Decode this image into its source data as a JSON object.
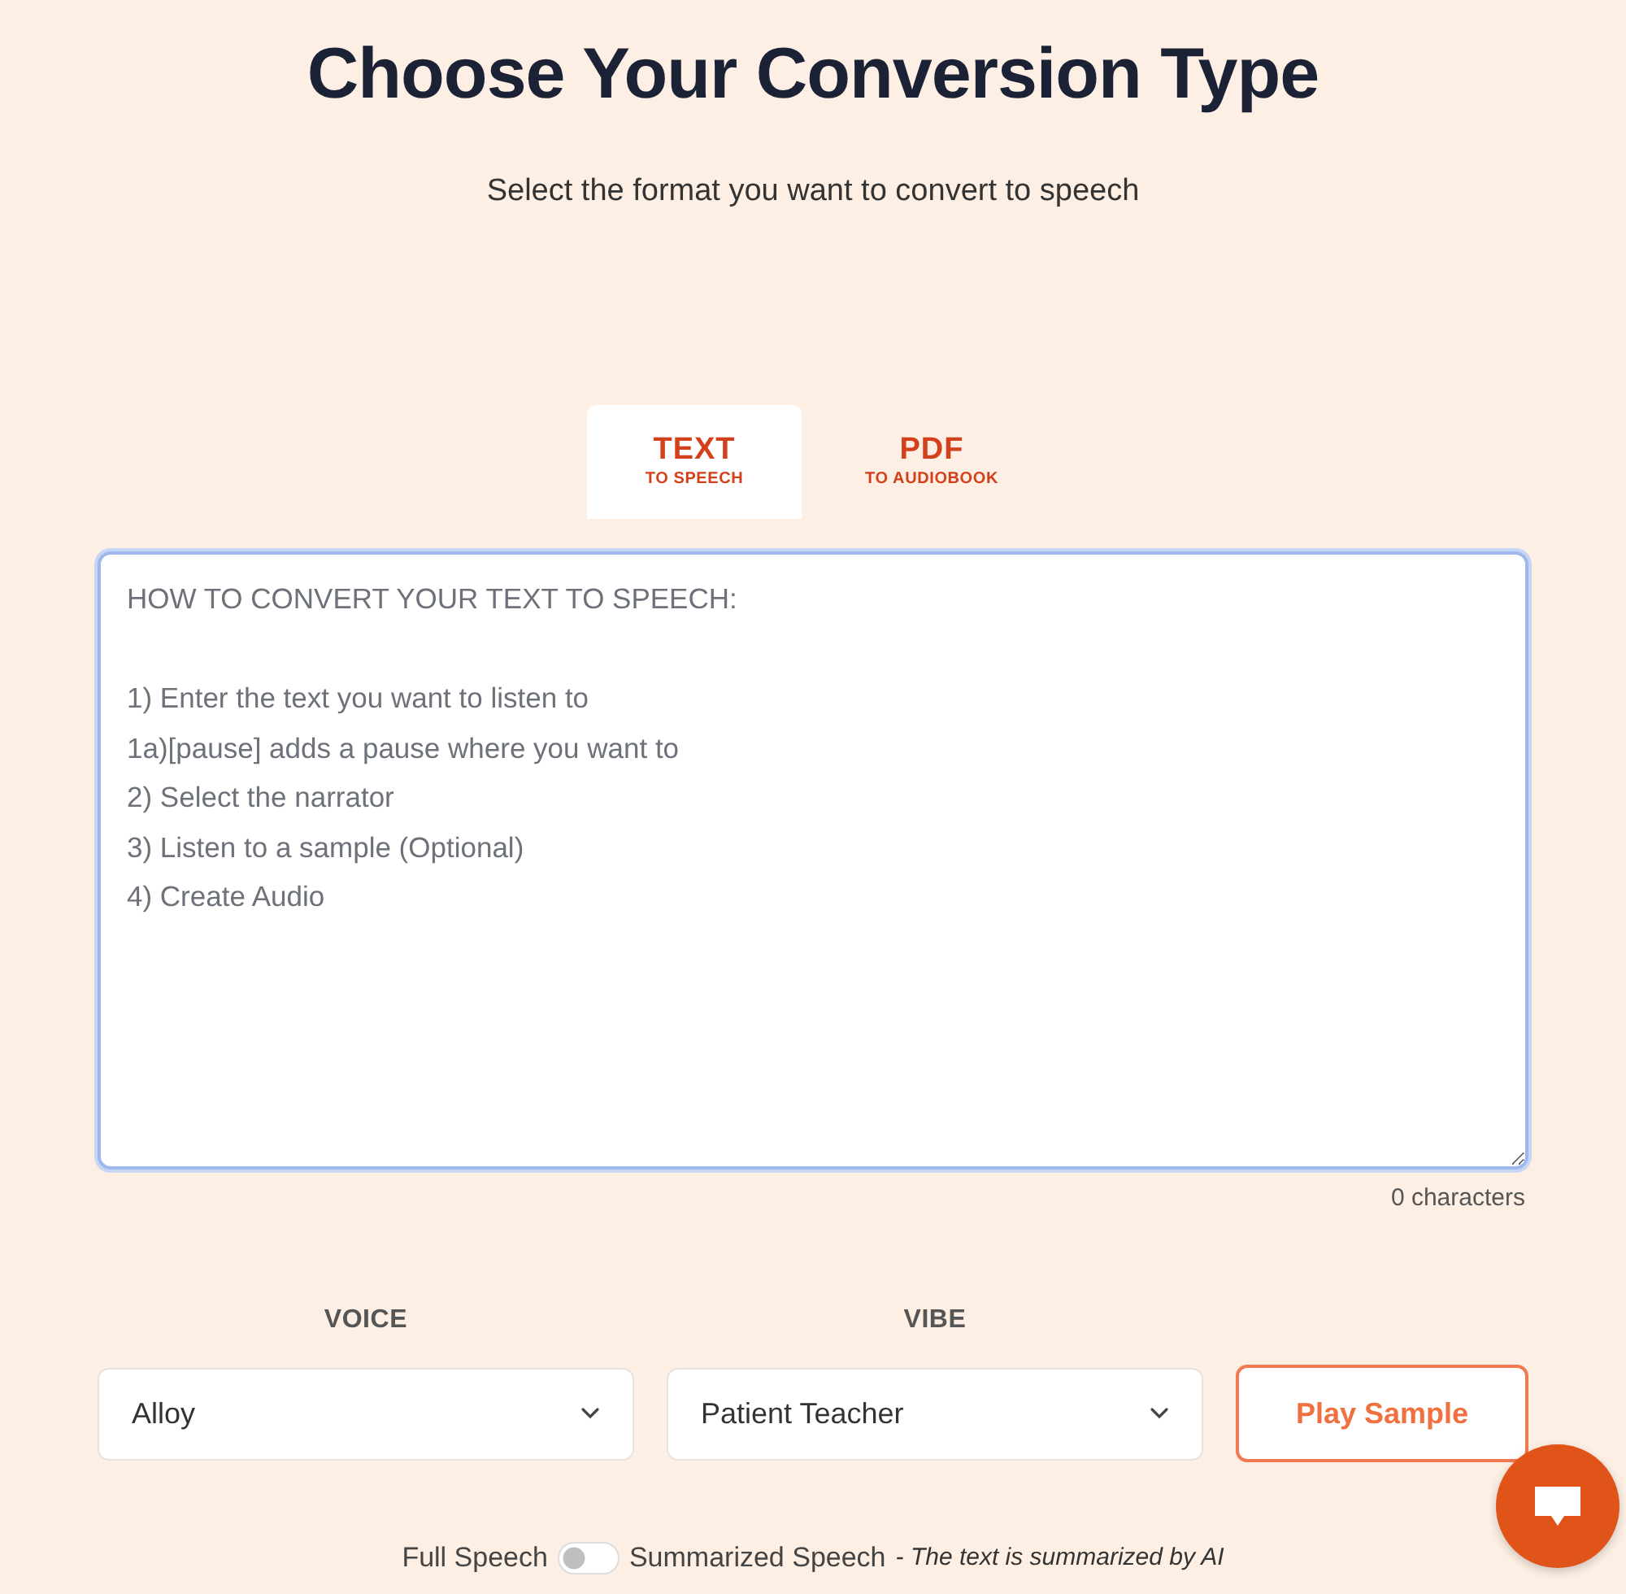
{
  "heading": {
    "title": "Choose Your Conversion Type",
    "subtitle": "Select the format you want to convert to speech"
  },
  "tabs": [
    {
      "label": "TEXT",
      "sublabel": "TO SPEECH",
      "selected": true
    },
    {
      "label": "PDF",
      "sublabel": "TO AUDIOBOOK",
      "selected": false
    }
  ],
  "editor": {
    "placeholder": "HOW TO CONVERT YOUR TEXT TO SPEECH:\n\n1) Enter the text you want to listen to\n1a)[pause] adds a pause where you want to\n2) Select the narrator\n3) Listen to a sample (Optional)\n4) Create Audio",
    "focused": true,
    "counter": "0 characters"
  },
  "settings": [
    {
      "label": "VOICE",
      "value": "Alloy"
    },
    {
      "label": "VIBE",
      "value": "Patient Teacher"
    }
  ],
  "sample_button": "Play Sample",
  "summary_toggle": {
    "left_label": "Full Speech",
    "on": false,
    "right_label": "Summarized Speech",
    "note": "- The text is summarized by AI"
  }
}
